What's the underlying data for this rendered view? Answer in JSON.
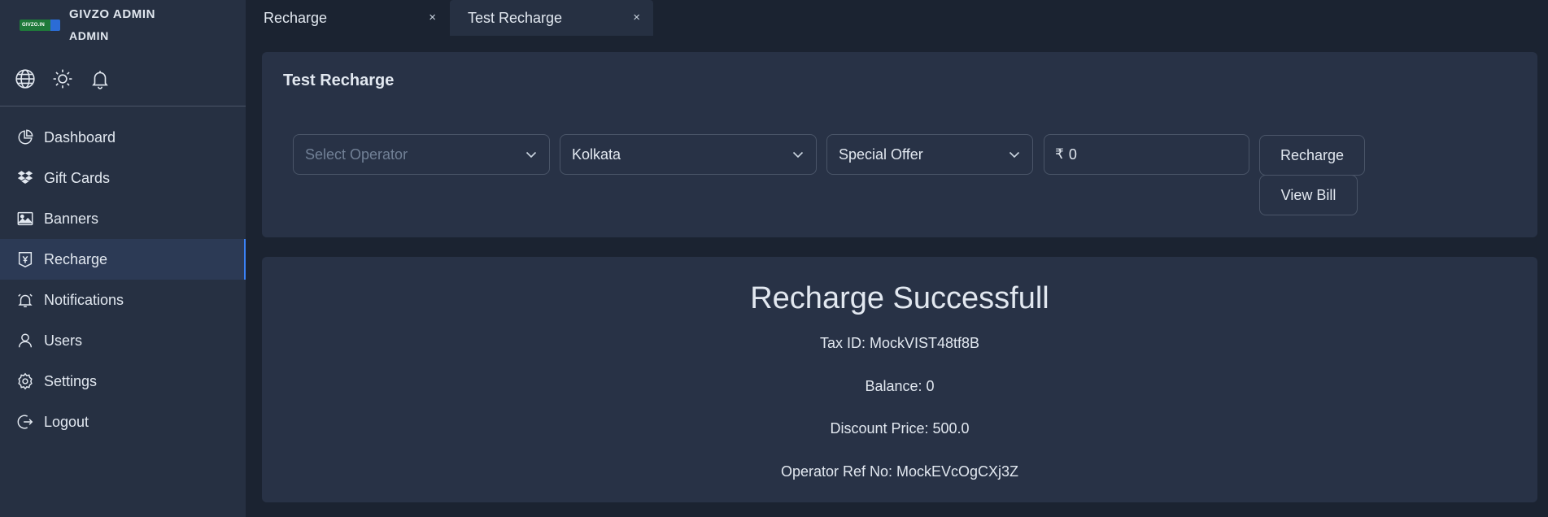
{
  "brand": {
    "logo_text": "GIVZO.IN",
    "name": "GIVZO ADMIN",
    "role": "ADMIN"
  },
  "header_icons": [
    "globe-icon",
    "sun-icon",
    "bell-icon"
  ],
  "sidebar": {
    "items": [
      {
        "label": "Dashboard",
        "icon": "pie-chart-icon",
        "active": false
      },
      {
        "label": "Gift Cards",
        "icon": "dropbox-icon",
        "active": false
      },
      {
        "label": "Banners",
        "icon": "image-icon",
        "active": false
      },
      {
        "label": "Recharge",
        "icon": "recharge-icon",
        "active": true
      },
      {
        "label": "Notifications",
        "icon": "alarm-icon",
        "active": false
      },
      {
        "label": "Users",
        "icon": "user-icon",
        "active": false
      },
      {
        "label": "Settings",
        "icon": "gear-icon",
        "active": false
      },
      {
        "label": "Logout",
        "icon": "logout-icon",
        "active": false
      }
    ]
  },
  "tabs": [
    {
      "label": "Recharge",
      "close": "×",
      "active": false
    },
    {
      "label": "Test Recharge",
      "close": "×",
      "active": true
    }
  ],
  "form": {
    "title": "Test Recharge",
    "operator_placeholder": "Select Operator",
    "circle_value": "Kolkata",
    "plan_value": "Special Offer",
    "currency_symbol": "₹",
    "amount_value": "0",
    "recharge_button": "Recharge",
    "view_bill_button": "View Bill"
  },
  "result": {
    "title": "Recharge Successfull",
    "tax_id": "Tax ID: MockVIST48tf8B",
    "balance": "Balance: 0",
    "discount_price": "Discount Price: 500.0",
    "operator_ref": "Operator Ref No: MockEVcOgCXj3Z"
  },
  "colors": {
    "background": "#1b2331",
    "sidebar": "#263042",
    "card": "#283246",
    "active_nav": "#2c3a55",
    "accent": "#3b82f6",
    "border": "#4a5568",
    "text": "#e2e8f0",
    "placeholder": "#718096"
  }
}
